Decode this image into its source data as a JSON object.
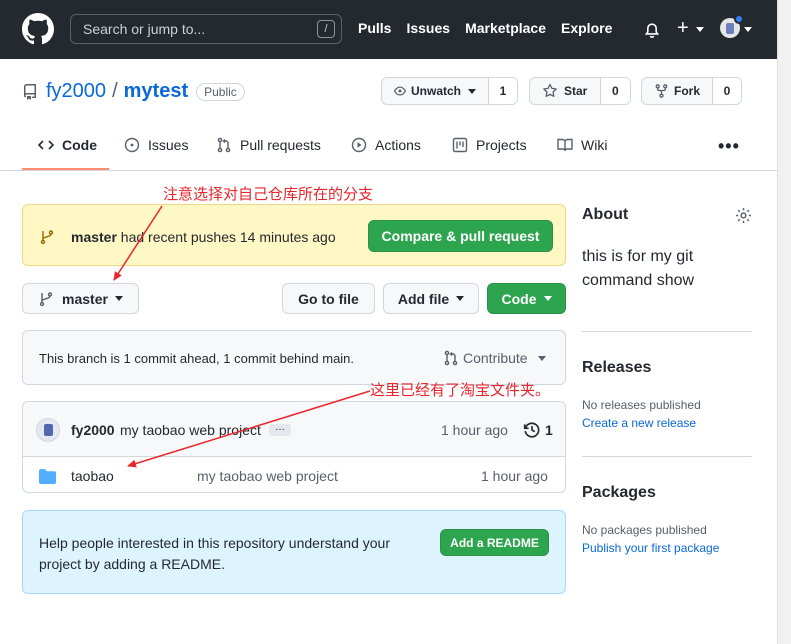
{
  "header": {
    "search_placeholder": "Search or jump to...",
    "search_shortcut": "/",
    "nav": [
      "Pulls",
      "Issues",
      "Marketplace",
      "Explore"
    ],
    "plus": "+"
  },
  "repo": {
    "owner": "fy2000",
    "separator": "/",
    "name": "mytest",
    "visibility": "Public",
    "unwatch_label": "Unwatch",
    "unwatch_count": "1",
    "star_label": "Star",
    "star_count": "0",
    "fork_label": "Fork",
    "fork_count": "0"
  },
  "tabs": [
    "Code",
    "Issues",
    "Pull requests",
    "Actions",
    "Projects",
    "Wiki"
  ],
  "more": "•••",
  "push_banner": {
    "branch": "master",
    "text": " had recent pushes 14 minutes ago",
    "button": "Compare & pull request"
  },
  "branch_bar": {
    "branch": "master",
    "go_to_file": "Go to file",
    "add_file": "Add file",
    "code": "Code"
  },
  "ahead": {
    "text": "This branch is 1 commit ahead, 1 commit behind main.",
    "contribute": "Contribute"
  },
  "commit": {
    "author": "fy2000",
    "message": "my taobao web project",
    "ellipsis": "…",
    "time": "1 hour ago",
    "count": "1"
  },
  "files": [
    {
      "name": "taobao",
      "message": "my taobao web project",
      "time": "1 hour ago"
    }
  ],
  "readme": {
    "text": "Help people interested in this repository understand your project by adding a README.",
    "button": "Add a README"
  },
  "sidebar": {
    "about_title": "About",
    "about_desc": "this is for my git command show",
    "releases_title": "Releases",
    "releases_empty": "No releases published",
    "releases_link": "Create a new release",
    "packages_title": "Packages",
    "packages_empty": "No packages published",
    "packages_link": "Publish your first package"
  },
  "annotations": {
    "top": "注意选择对自己仓库所在的分支",
    "middle": "这里已经有了淘宝文件夹。"
  },
  "colors": {
    "header_bg": "#24292f",
    "link": "#0969da",
    "green": "#2da44e",
    "tab_accent": "#fd8c73",
    "banner_yellow": "#fff8c5",
    "readme_blue": "#ddf4ff",
    "annotation_red": "#e8262c"
  }
}
